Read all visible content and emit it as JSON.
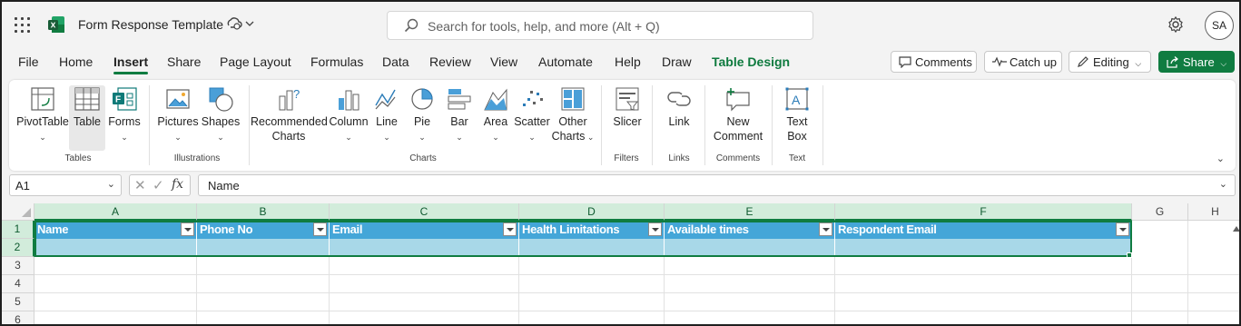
{
  "app": {
    "document_title": "Form Response Template",
    "search_placeholder": "Search for tools, help, and more (Alt + Q)",
    "user_initials": "SA",
    "brand_color": "#107c41"
  },
  "menu_tabs": [
    "File",
    "Home",
    "Insert",
    "Share",
    "Page Layout",
    "Formulas",
    "Data",
    "Review",
    "View",
    "Automate",
    "Help",
    "Draw",
    "Table Design"
  ],
  "active_tab": "Insert",
  "top_buttons": {
    "comments": "Comments",
    "catch_up": "Catch up",
    "editing": "Editing",
    "share": "Share"
  },
  "ribbon": {
    "pivottable": "PivotTable",
    "table": "Table",
    "forms": "Forms",
    "pictures": "Pictures",
    "shapes": "Shapes",
    "recommended_1": "Recommended",
    "recommended_2": "Charts",
    "column": "Column",
    "line": "Line",
    "pie": "Pie",
    "bar": "Bar",
    "area": "Area",
    "scatter": "Scatter",
    "other_1": "Other",
    "other_2": "Charts",
    "slicer": "Slicer",
    "link": "Link",
    "new_comment_1": "New",
    "new_comment_2": "Comment",
    "textbox_1": "Text",
    "textbox_2": "Box",
    "groups": {
      "tables": "Tables",
      "illustrations": "Illustrations",
      "charts": "Charts",
      "filters": "Filters",
      "links": "Links",
      "comments": "Comments",
      "text": "Text"
    }
  },
  "formula_bar": {
    "name_box": "A1",
    "formula": "Name"
  },
  "grid": {
    "columns": [
      "A",
      "B",
      "C",
      "D",
      "E",
      "F",
      "G",
      "H"
    ],
    "rows": [
      "1",
      "2",
      "3",
      "4",
      "5",
      "6"
    ],
    "table_headers": [
      "Name",
      "Phone No",
      "Email",
      "Health Limitations",
      "Available times",
      "Respondent Email"
    ],
    "header_color": "#44a6d8",
    "row_color": "#a8d8e8"
  }
}
